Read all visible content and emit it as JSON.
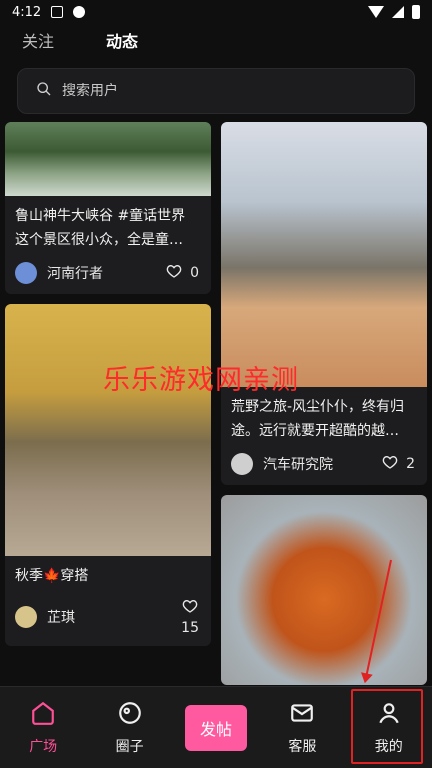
{
  "status_bar": {
    "time": "4:12"
  },
  "tabs": [
    {
      "label": "关注",
      "active": false
    },
    {
      "label": "动态",
      "active": true
    }
  ],
  "search": {
    "placeholder": "搜索用户"
  },
  "feed": {
    "left": [
      {
        "text": "鲁山神牛大峡谷 #童话世界 这个景区很小众，全是童…",
        "author": "河南行者",
        "likes": "0"
      },
      {
        "text": "秋季🍁穿搭",
        "author": "芷琪",
        "likes": "15"
      }
    ],
    "right": [
      {
        "text": "荒野之旅-风尘仆仆，终有归途。远行就要开超酷的越…",
        "author": "汽车研究院",
        "likes": "2"
      },
      {
        "text": "",
        "author": "",
        "likes": ""
      }
    ]
  },
  "watermark": "乐乐游戏网亲测",
  "nav": [
    {
      "label": "广场",
      "active": true
    },
    {
      "label": "圈子",
      "active": false
    },
    {
      "label": "发帖",
      "active": false
    },
    {
      "label": "客服",
      "active": false
    },
    {
      "label": "我的",
      "active": false
    }
  ],
  "colors": {
    "accent": "#ff4f96",
    "background": "#0f0f10"
  }
}
